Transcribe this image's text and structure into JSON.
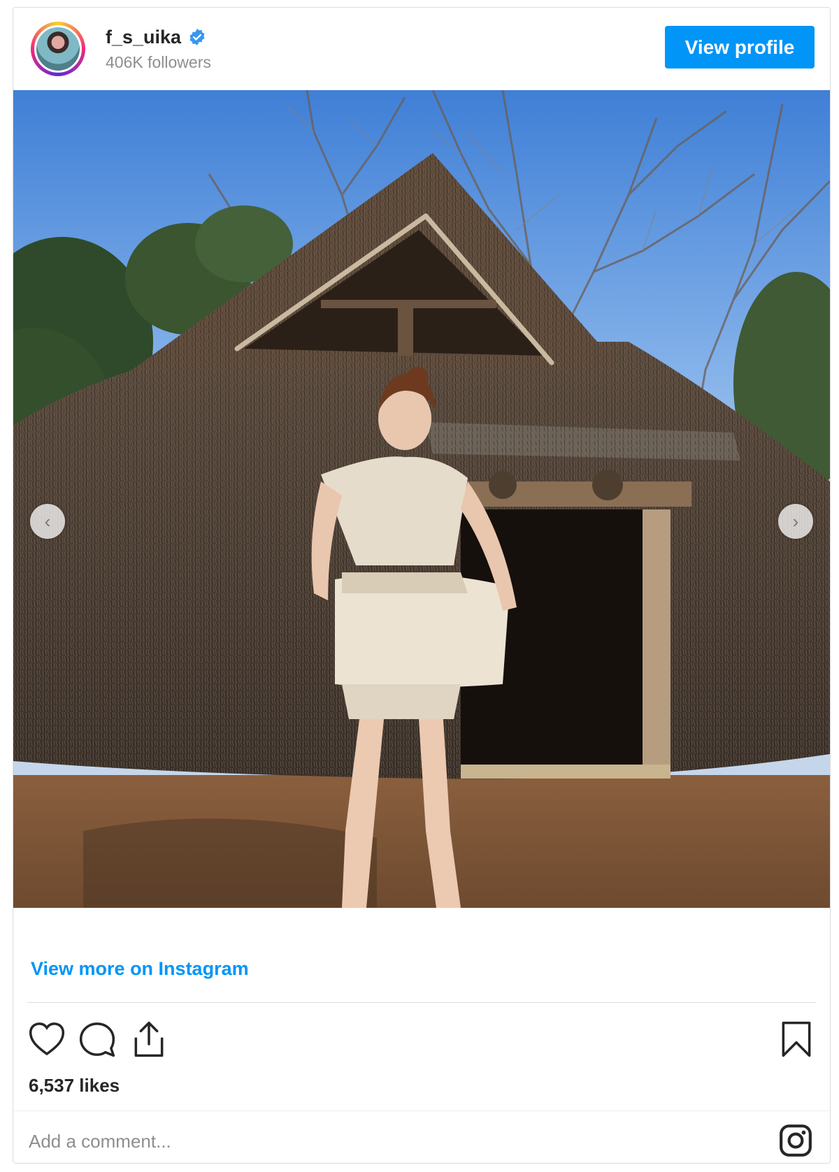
{
  "header": {
    "username": "f_s_uika",
    "verified": true,
    "followers": "406K followers",
    "view_profile_label": "View profile"
  },
  "post": {
    "image_alt": "Photo of woman in front of thatched hut",
    "carousel_prev": "‹",
    "carousel_next": "›"
  },
  "footer": {
    "view_more_label": "View more on Instagram",
    "likes": "6,537 likes",
    "comment_placeholder": "Add a comment..."
  },
  "icons": {
    "like": "heart-icon",
    "comment": "comment-icon",
    "share": "share-icon",
    "save": "bookmark-icon",
    "brand": "instagram-icon",
    "verified": "verified-badge-icon"
  },
  "colors": {
    "accent": "#0095f6",
    "text": "#262626",
    "muted": "#8e8e8e",
    "border": "#dbdbdb"
  }
}
